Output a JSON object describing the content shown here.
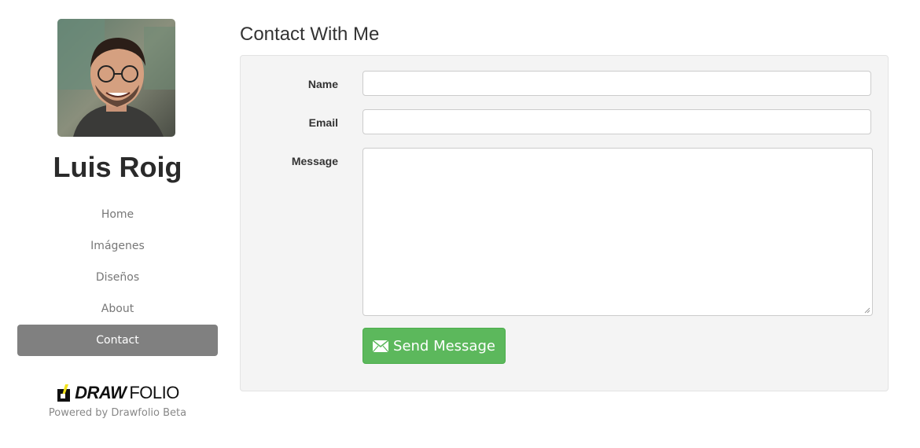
{
  "sidebar": {
    "name": "Luis Roig",
    "nav": [
      {
        "label": "Home"
      },
      {
        "label": "Imágenes"
      },
      {
        "label": "Diseños"
      },
      {
        "label": "About"
      },
      {
        "label": "Contact",
        "active": true
      }
    ],
    "brand": {
      "draw": "DRAW",
      "folio": "FOLIO",
      "powered": "Powered by Drawfolio Beta"
    }
  },
  "main": {
    "title": "Contact With Me",
    "form": {
      "name_label": "Name",
      "name_value": "",
      "email_label": "Email",
      "email_value": "",
      "message_label": "Message",
      "message_value": "",
      "send_label": "Send Message",
      "send_icon": "envelope-icon"
    }
  },
  "colors": {
    "active_nav": "#808080",
    "send_button": "#5cb85c",
    "panel_bg": "#f4f4f4"
  }
}
